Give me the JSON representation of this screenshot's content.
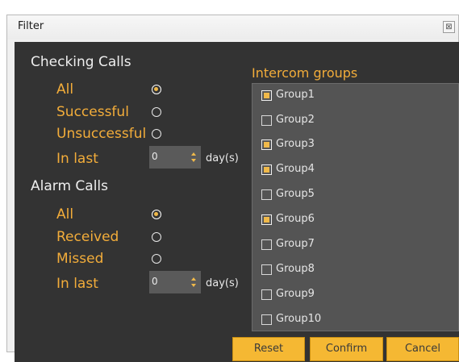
{
  "window": {
    "title": "Filter",
    "close_glyph": "⊠"
  },
  "checking_calls": {
    "title": "Checking Calls",
    "options": [
      {
        "label": "All",
        "checked": true
      },
      {
        "label": "Successful",
        "checked": false
      },
      {
        "label": "Unsuccessful",
        "checked": false
      }
    ],
    "in_last": {
      "label": "In last",
      "value": "0",
      "unit": "day(s)"
    }
  },
  "alarm_calls": {
    "title": "Alarm Calls",
    "options": [
      {
        "label": "All",
        "checked": true
      },
      {
        "label": "Received",
        "checked": false
      },
      {
        "label": "Missed",
        "checked": false
      }
    ],
    "in_last": {
      "label": "In last",
      "value": "0",
      "unit": "day(s)"
    }
  },
  "intercom_groups": {
    "title": "Intercom groups",
    "items": [
      {
        "label": "Group1",
        "checked": true
      },
      {
        "label": "Group2",
        "checked": false
      },
      {
        "label": "Group3",
        "checked": true
      },
      {
        "label": "Group4",
        "checked": true
      },
      {
        "label": "Group5",
        "checked": false
      },
      {
        "label": "Group6",
        "checked": true
      },
      {
        "label": "Group7",
        "checked": false
      },
      {
        "label": "Group8",
        "checked": false
      },
      {
        "label": "Group9",
        "checked": false
      },
      {
        "label": "Group10",
        "checked": false
      }
    ]
  },
  "buttons": {
    "reset": "Reset",
    "confirm": "Confirm",
    "cancel": "Cancel"
  },
  "colors": {
    "accent": "#f0b94a",
    "panel": "#333333",
    "button": "#f5b833"
  }
}
